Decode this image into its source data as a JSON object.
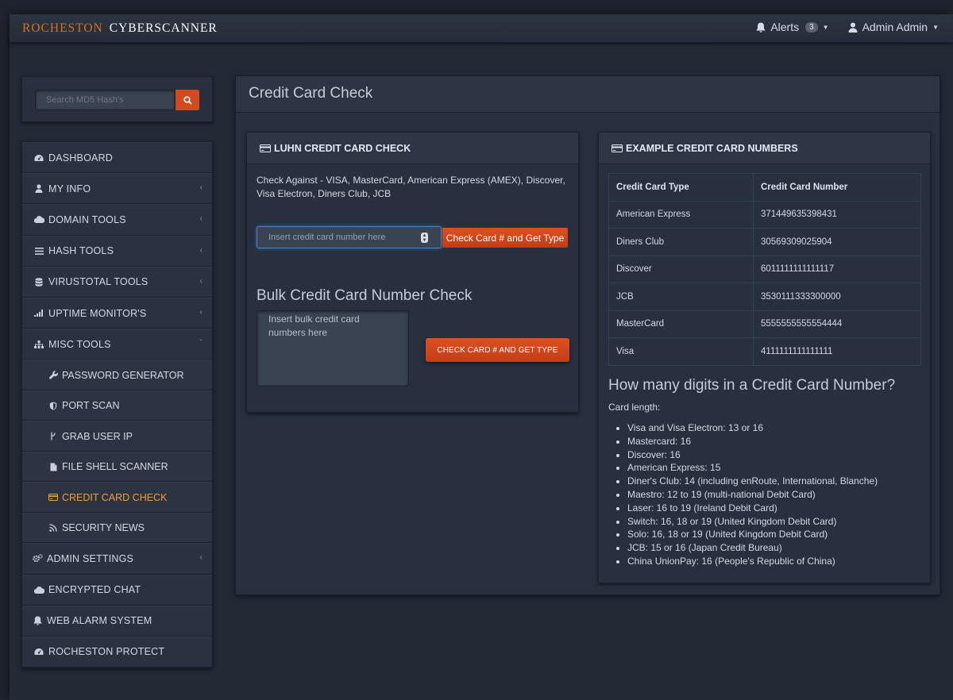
{
  "header": {
    "brand_part1": "ROCHESTON",
    "brand_part2": "CYBERSCANNER",
    "alerts_label": "Alerts",
    "alerts_count": "3",
    "user_label": "Admin Admin"
  },
  "search": {
    "placeholder": "Search MD5 Hash's"
  },
  "nav": {
    "dashboard": "DASHBOARD",
    "my_info": "MY INFO",
    "domain_tools": "DOMAIN TOOLS",
    "hash_tools": "HASH TOOLS",
    "virustotal_tools": "VIRUSTOTAL TOOLS",
    "uptime_monitors": "UPTIME MONITOR'S",
    "misc_tools": "MISC TOOLS",
    "sub": {
      "password_generator": "PASSWORD GENERATOR",
      "port_scan": "PORT SCAN",
      "grab_user_ip": "GRAB USER IP",
      "file_shell_scanner": "FILE SHELL SCANNER",
      "credit_card_check": "CREDIT CARD CHECK",
      "security_news": "SECURITY NEWS"
    },
    "admin_settings": "ADMIN SETTINGS",
    "encrypted_chat": "ENCRYPTED CHAT",
    "web_alarm_system": "WEB ALARM SYSTEM",
    "rocheston_protect": "ROCHESTON PROTECT"
  },
  "page": {
    "title": "Credit Card Check"
  },
  "luhn": {
    "header": "LUHN CREDIT CARD CHECK",
    "description": "Check Against - VISA, MasterCard, American Express (AMEX), Discover, Visa Electron, Diners Club, JCB",
    "input_placeholder": "Insert credit card number here",
    "check_button": "Check Card # and Get Type",
    "bulk_title": "Bulk Credit Card Number Check",
    "bulk_placeholder": "Insert bulk credit card numbers here",
    "bulk_button": "CHECK CARD # AND GET TYPE"
  },
  "examples": {
    "header": "EXAMPLE CREDIT CARD NUMBERS",
    "col_type": "Credit Card Type",
    "col_number": "Credit Card Number",
    "rows": [
      {
        "type": "American Express",
        "number": "371449635398431"
      },
      {
        "type": "Diners Club",
        "number": "30569309025904"
      },
      {
        "type": "Discover",
        "number": "6011111111111117"
      },
      {
        "type": "JCB",
        "number": "3530111333300000"
      },
      {
        "type": "MasterCard",
        "number": "5555555555554444"
      },
      {
        "type": "Visa",
        "number": "4111111111111111"
      }
    ],
    "digits_title": "How many digits in a Credit Card Number?",
    "card_length_label": "Card length:",
    "lengths": [
      "Visa and Visa Electron: 13 or 16",
      "Mastercard: 16",
      "Discover: 16",
      "American Express: 15",
      "Diner's Club: 14 (including enRoute, International, Blanche)",
      "Maestro: 12 to 19 (multi-national Debit Card)",
      "Laser: 16 to 19 (Ireland Debit Card)",
      "Switch: 16, 18 or 19 (United Kingdom Debit Card)",
      "Solo: 16, 18 or 19 (United Kingdom Debit Card)",
      "JCB: 15 or 16 (Japan Credit Bureau)",
      "China UnionPay: 16 (People's Republic of China)"
    ]
  },
  "colors": {
    "accent": "#d24a1f",
    "active_nav": "#f39c31",
    "brand": "#d4731e",
    "background": "#1f2530"
  },
  "icons": {
    "search": "search-icon",
    "bell": "bell-icon",
    "user": "user-icon",
    "credit_card": "credit-card-icon"
  }
}
